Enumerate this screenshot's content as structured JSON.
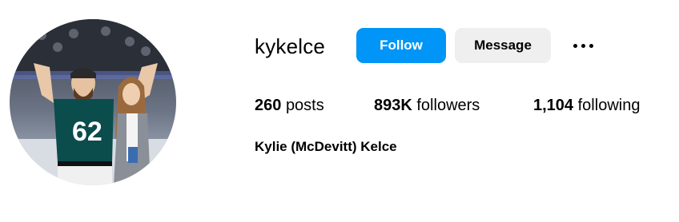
{
  "profile": {
    "username": "kykelce",
    "full_name": "Kylie (McDevitt) Kelce",
    "avatar_icon": "profile-photo"
  },
  "actions": {
    "follow_label": "Follow",
    "message_label": "Message",
    "more_icon": "more-options-icon"
  },
  "stats": {
    "posts_count": "260",
    "posts_label": "posts",
    "followers_count": "893K",
    "followers_label": "followers",
    "following_count": "1,104",
    "following_label": "following"
  },
  "colors": {
    "accent": "#0095f6",
    "secondary_button": "#efefef",
    "jersey": "#0b4c4d",
    "jersey_number": "62"
  }
}
